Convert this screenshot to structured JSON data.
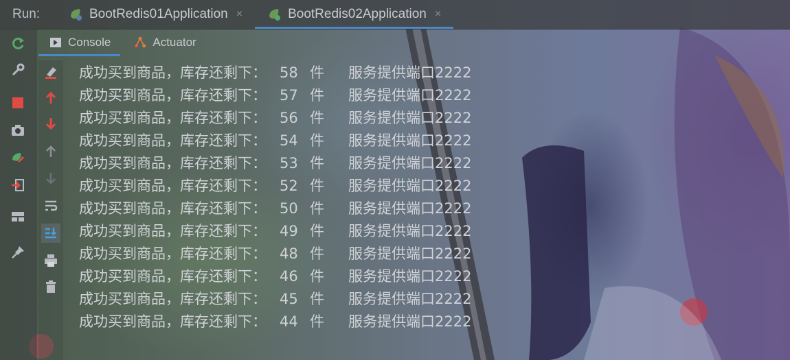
{
  "run_bar": {
    "label": "Run:",
    "tabs": [
      {
        "label": "BootRedis01Application",
        "active": false
      },
      {
        "label": "BootRedis02Application",
        "active": true
      }
    ],
    "close_glyph": "×"
  },
  "sub_tabs": [
    {
      "label": "Console",
      "icon": "console-icon",
      "active": true
    },
    {
      "label": "Actuator",
      "icon": "actuator-icon",
      "active": false
    }
  ],
  "left_rail_icons": [
    "rerun-icon",
    "wrench-icon",
    "stop-icon",
    "camera-icon",
    "restore-icon",
    "exit-icon",
    "layout-icon",
    "pin-icon"
  ],
  "tool_rail_icons": [
    "clear-icon",
    "up-arrow-red-icon",
    "down-arrow-red-icon",
    "up-arrow-icon",
    "down-arrow-icon",
    "soft-wrap-icon",
    "scroll-to-end-icon",
    "print-icon",
    "trash-icon"
  ],
  "console": {
    "lines": [
      {
        "message": "成功买到商品，库存还剩下：",
        "stock": "58",
        "unit": "件",
        "service": "服务提供端口2222"
      },
      {
        "message": "成功买到商品，库存还剩下：",
        "stock": "57",
        "unit": "件",
        "service": "服务提供端口2222"
      },
      {
        "message": "成功买到商品，库存还剩下：",
        "stock": "56",
        "unit": "件",
        "service": "服务提供端口2222"
      },
      {
        "message": "成功买到商品，库存还剩下：",
        "stock": "54",
        "unit": "件",
        "service": "服务提供端口2222"
      },
      {
        "message": "成功买到商品，库存还剩下：",
        "stock": "53",
        "unit": "件",
        "service": "服务提供端口2222"
      },
      {
        "message": "成功买到商品，库存还剩下：",
        "stock": "52",
        "unit": "件",
        "service": "服务提供端口2222"
      },
      {
        "message": "成功买到商品，库存还剩下：",
        "stock": "50",
        "unit": "件",
        "service": "服务提供端口2222"
      },
      {
        "message": "成功买到商品，库存还剩下：",
        "stock": "49",
        "unit": "件",
        "service": "服务提供端口2222"
      },
      {
        "message": "成功买到商品，库存还剩下：",
        "stock": "48",
        "unit": "件",
        "service": "服务提供端口2222"
      },
      {
        "message": "成功买到商品，库存还剩下：",
        "stock": "46",
        "unit": "件",
        "service": "服务提供端口2222"
      },
      {
        "message": "成功买到商品，库存还剩下：",
        "stock": "45",
        "unit": "件",
        "service": "服务提供端口2222"
      },
      {
        "message": "成功买到商品，库存还剩下：",
        "stock": "44",
        "unit": "件",
        "service": "服务提供端口2222"
      }
    ]
  },
  "colors": {
    "accent": "#4a88c7",
    "text": "#cfd2d6",
    "stop": "#e04c44",
    "rerun": "#59a869"
  }
}
